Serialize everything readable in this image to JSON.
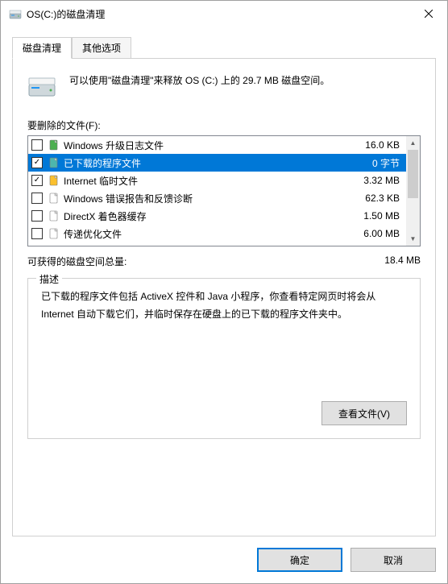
{
  "window": {
    "title": "OS(C:)的磁盘清理"
  },
  "tabs": {
    "cleanup": "磁盘清理",
    "other": "其他选项"
  },
  "intro": "可以使用\"磁盘清理\"来释放 OS (C:) 上的 29.7 MB 磁盘空间。",
  "files_label": "要删除的文件(F):",
  "files": [
    {
      "checked": false,
      "name": "Windows 升级日志文件",
      "size": "16.0 KB",
      "selected": false,
      "iconColor": "#4caf50"
    },
    {
      "checked": true,
      "name": "已下载的程序文件",
      "size": "0 字节",
      "selected": true,
      "iconColor": "#4db6ac"
    },
    {
      "checked": true,
      "name": "Internet 临时文件",
      "size": "3.32 MB",
      "selected": false,
      "iconColor": "#fbc02d"
    },
    {
      "checked": false,
      "name": "Windows 错误报告和反馈诊断",
      "size": "62.3 KB",
      "selected": false,
      "iconColor": "#ffffff"
    },
    {
      "checked": false,
      "name": "DirectX 着色器缓存",
      "size": "1.50 MB",
      "selected": false,
      "iconColor": "#ffffff"
    },
    {
      "checked": false,
      "name": "传递优化文件",
      "size": "6.00 MB",
      "selected": false,
      "iconColor": "#ffffff"
    }
  ],
  "total": {
    "label": "可获得的磁盘空间总量:",
    "value": "18.4 MB"
  },
  "description": {
    "legend": "描述",
    "text": "已下载的程序文件包括 ActiveX 控件和 Java 小程序，你查看特定网页时将会从 Internet 自动下载它们，并临时保存在硬盘上的已下载的程序文件夹中。"
  },
  "buttons": {
    "view_files": "查看文件(V)",
    "ok": "确定",
    "cancel": "取消"
  }
}
